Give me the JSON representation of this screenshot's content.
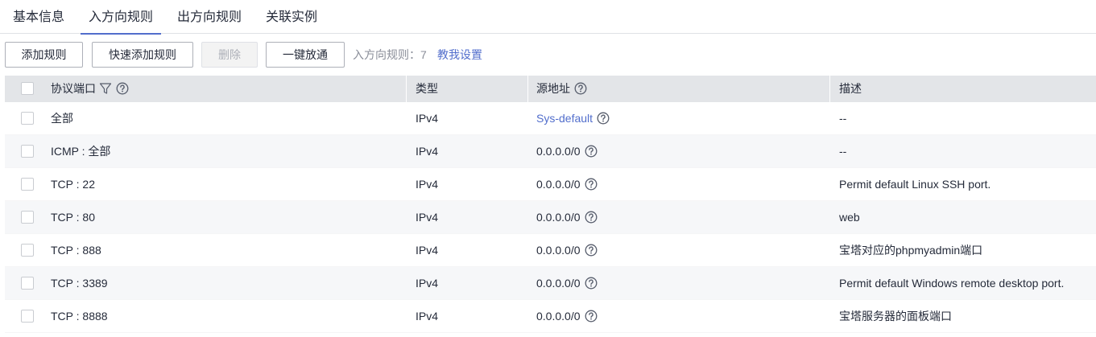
{
  "tabs": [
    {
      "label": "基本信息"
    },
    {
      "label": "入方向规则"
    },
    {
      "label": "出方向规则"
    },
    {
      "label": "关联实例"
    }
  ],
  "toolbar": {
    "add_rule": "添加规则",
    "quick_add_rule": "快速添加规则",
    "delete": "删除",
    "one_click_open": "一键放通",
    "rule_count_label": "入方向规则：",
    "rule_count": "7",
    "help_link": "教我设置"
  },
  "table": {
    "headers": {
      "protocol_port": "协议端口",
      "type": "类型",
      "source": "源地址",
      "description": "描述"
    },
    "rows": [
      {
        "protocol_port": "全部",
        "type": "IPv4",
        "source": "Sys-default",
        "description": "--"
      },
      {
        "protocol_port": "ICMP : 全部",
        "type": "IPv4",
        "source": "0.0.0.0/0",
        "description": "--"
      },
      {
        "protocol_port": "TCP : 22",
        "type": "IPv4",
        "source": "0.0.0.0/0",
        "description": "Permit default Linux SSH port."
      },
      {
        "protocol_port": "TCP : 80",
        "type": "IPv4",
        "source": "0.0.0.0/0",
        "description": "web"
      },
      {
        "protocol_port": "TCP : 888",
        "type": "IPv4",
        "source": "0.0.0.0/0",
        "description": "宝塔对应的phpmyadmin端口"
      },
      {
        "protocol_port": "TCP : 3389",
        "type": "IPv4",
        "source": "0.0.0.0/0",
        "description": "Permit default Windows remote desktop port."
      },
      {
        "protocol_port": "TCP : 8888",
        "type": "IPv4",
        "source": "0.0.0.0/0",
        "description": "宝塔服务器的面板端口"
      }
    ]
  },
  "colors": {
    "accent": "#526ecc",
    "header_bg": "#e3e5e8",
    "alt_row_bg": "#f6f7f9"
  },
  "icons": {
    "filter": "filter-icon",
    "help": "question-circle-icon"
  }
}
